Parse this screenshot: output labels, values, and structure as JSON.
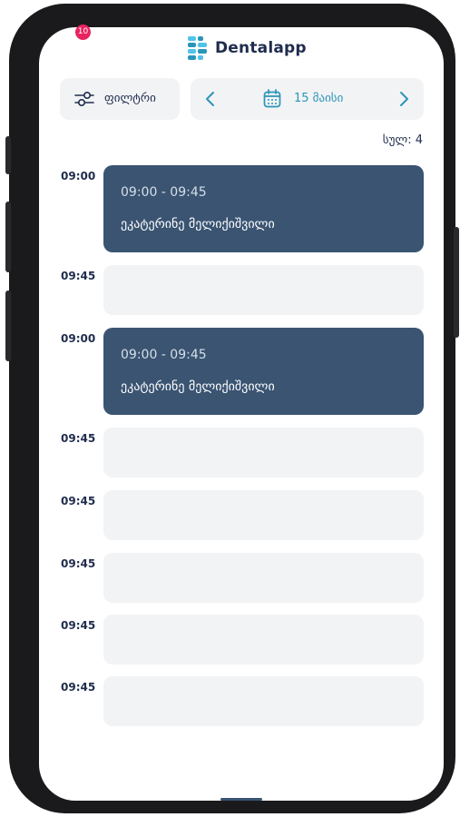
{
  "app": {
    "name": "Dentalapp",
    "notification_count": "10"
  },
  "toolbar": {
    "filter_label": "ფილტრი",
    "date_label": "15 მაისი",
    "total_label": "სულ: 4"
  },
  "icons": {
    "filter": "sliders-icon",
    "calendar": "calendar-icon",
    "prev": "chevron-left-icon",
    "next": "chevron-right-icon"
  },
  "colors": {
    "brand": "#2a95b8",
    "booked": "#3a5472",
    "empty": "#f2f3f5",
    "badge": "#e8235f"
  },
  "schedule": [
    {
      "time": "09:00",
      "booked": true,
      "range": "09:00 - 09:45",
      "patient": "ეკატერინე მელიქიშვილი"
    },
    {
      "time": "09:45",
      "booked": false
    },
    {
      "time": "09:00",
      "booked": true,
      "range": "09:00 - 09:45",
      "patient": "ეკატერინე მელიქიშვილი"
    },
    {
      "time": "09:45",
      "booked": false
    },
    {
      "time": "09:45",
      "booked": false
    },
    {
      "time": "09:45",
      "booked": false
    },
    {
      "time": "09:45",
      "booked": false
    },
    {
      "time": "09:45",
      "booked": false
    }
  ]
}
